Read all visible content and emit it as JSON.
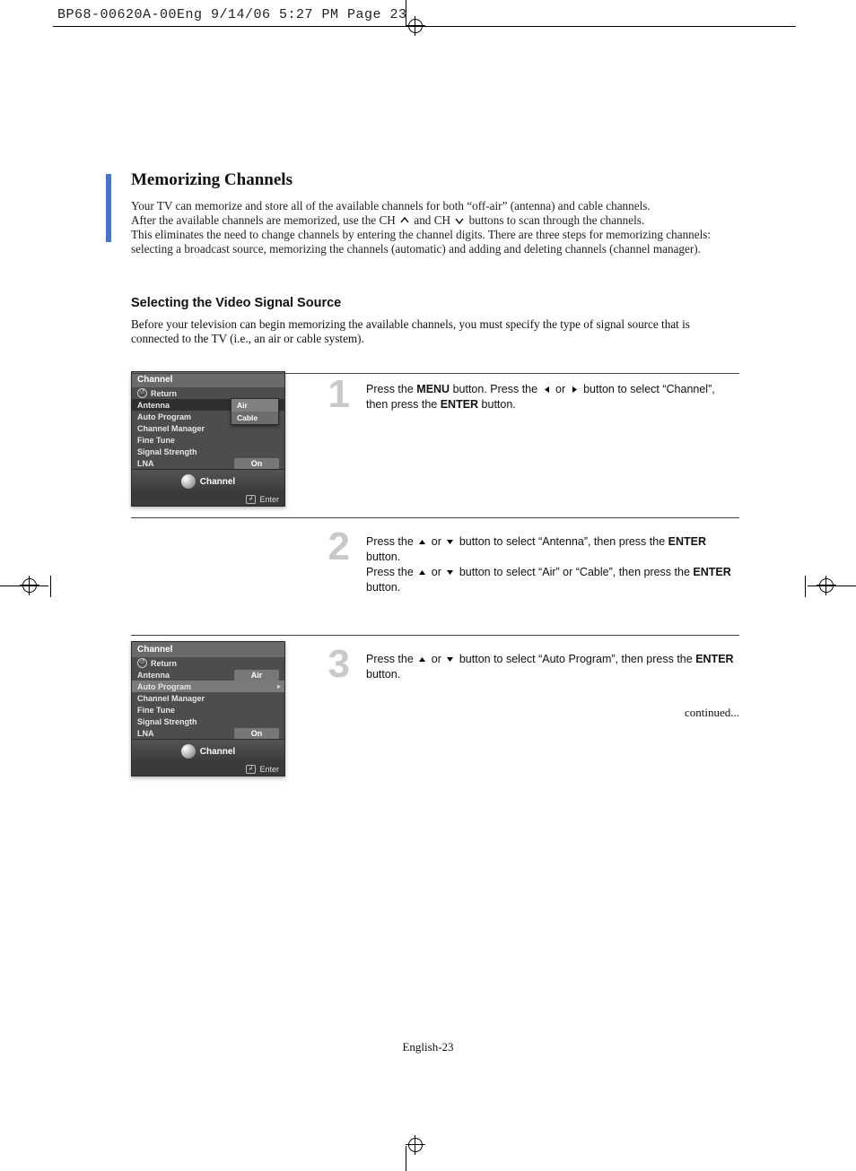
{
  "slug": "BP68-00620A-00Eng  9/14/06  5:27 PM  Page 23",
  "heading": "Memorizing Channels",
  "intro_line1": "Your TV can memorize and store all of the available channels for both “off-air” (antenna) and cable channels.",
  "intro_line2a": "After the available channels are memorized, use the CH ",
  "intro_line2b": " and CH ",
  "intro_line2c": " buttons to scan through the channels.",
  "intro_line3": "This eliminates the need to change channels by entering the channel digits. There are three steps for memorizing channels:",
  "intro_line4": "selecting a broadcast source, memorizing the channels (automatic) and adding and deleting channels (channel manager).",
  "subheading": "Selecting the Video Signal Source",
  "lead": "Before your television can begin memorizing the available channels, you must specify the type of signal source that is connected to the TV (i.e., an air or cable system).",
  "step1": {
    "num": "1",
    "a": "Press the ",
    "b": "MENU",
    "c": " button. Press the ",
    "d": " or ",
    "e": " button to select “Channel”, then press the ",
    "f": "ENTER",
    "g": " button."
  },
  "step2": {
    "num": "2",
    "a": "Press the ",
    "b": " or ",
    "c": " button to select “Antenna”, then press the ",
    "d": "ENTER",
    "e": " button.",
    "f": "Press the ",
    "g": " or ",
    "h": " button to select “Air” or “Cable”, then press the ",
    "i": "ENTER",
    "j": " button."
  },
  "step3": {
    "num": "3",
    "a": "Press the ",
    "b": " or ",
    "c": " button to select “Auto Program”, then press the ",
    "d": "ENTER",
    "e": " button."
  },
  "menu1": {
    "title": "Channel",
    "return": "Return",
    "items": [
      "Antenna",
      "Auto Program",
      "Channel Manager",
      "Fine Tune",
      "Signal Strength",
      "LNA"
    ],
    "antenna_air": "Air",
    "antenna_cable": "Cable",
    "lna_val": "On",
    "footer_label": "Channel",
    "enter": "Enter"
  },
  "menu2": {
    "title": "Channel",
    "return": "Return",
    "items": [
      "Antenna",
      "Auto Program",
      "Channel Manager",
      "Fine Tune",
      "Signal Strength",
      "LNA"
    ],
    "antenna_val": "Air",
    "lna_val": "On",
    "footer_label": "Channel",
    "enter": "Enter"
  },
  "continued": "continued...",
  "page_number": "English-23"
}
